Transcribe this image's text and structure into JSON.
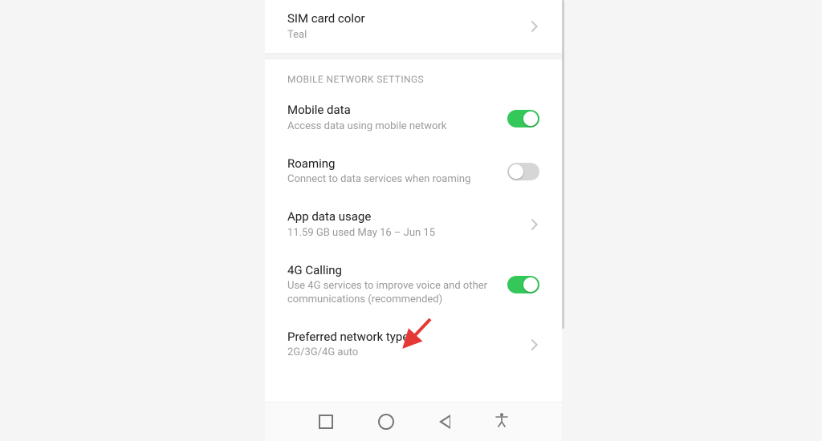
{
  "colors": {
    "accent_green": "#34C759"
  },
  "sim_color": {
    "title": "SIM card color",
    "value": "Teal"
  },
  "section_header": "MOBILE NETWORK SETTINGS",
  "mobile_data": {
    "title": "Mobile data",
    "sub": "Access data using mobile network",
    "on": true
  },
  "roaming": {
    "title": "Roaming",
    "sub": "Connect to data services when roaming",
    "on": false
  },
  "app_data": {
    "title": "App data usage",
    "sub": "11.59 GB used May 16 – Jun 15"
  },
  "calling4g": {
    "title": "4G Calling",
    "sub": "Use 4G services to improve voice and other communications (recommended)",
    "on": true
  },
  "preferred": {
    "title": "Preferred network type",
    "sub": "2G/3G/4G auto"
  }
}
